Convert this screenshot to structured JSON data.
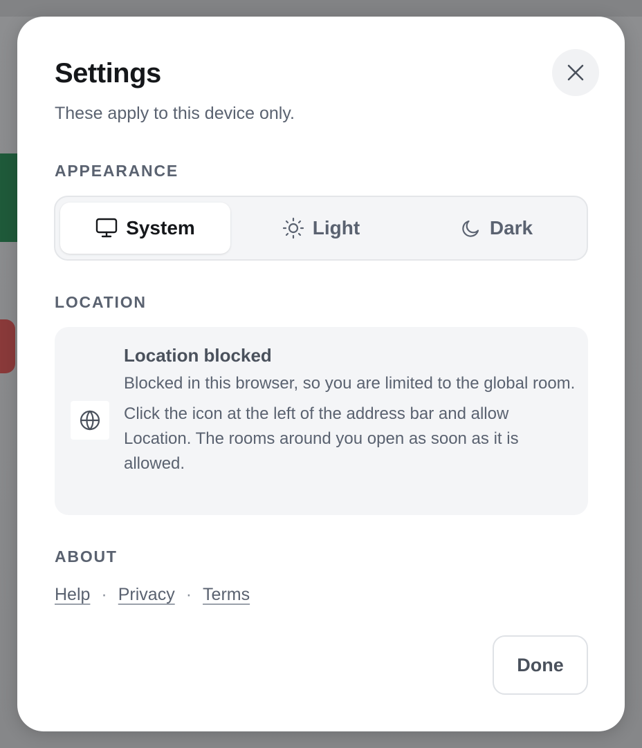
{
  "dialog": {
    "title": "Settings",
    "subtitle": "These apply to this device only.",
    "close_icon": "close-icon"
  },
  "appearance": {
    "label": "APPEARANCE",
    "options": [
      {
        "label": "System",
        "icon": "monitor-icon",
        "active": true
      },
      {
        "label": "Light",
        "icon": "sun-icon",
        "active": false
      },
      {
        "label": "Dark",
        "icon": "moon-icon",
        "active": false
      }
    ]
  },
  "location": {
    "label": "LOCATION",
    "icon": "globe-icon",
    "title": "Location blocked",
    "paragraph1": "Blocked in this browser, so you are limited to the global room.",
    "paragraph2": "Click the icon at the left of the address bar and allow Location. The rooms around you open as soon as it is allowed."
  },
  "about": {
    "label": "ABOUT",
    "links": [
      "Help",
      "Privacy",
      "Terms"
    ],
    "separator": "·"
  },
  "footer": {
    "done_label": "Done"
  },
  "colors": {
    "text_primary": "#15171a",
    "text_secondary": "#5a6270",
    "surface_muted": "#f4f5f7",
    "overlay": "#8a8b8d"
  }
}
